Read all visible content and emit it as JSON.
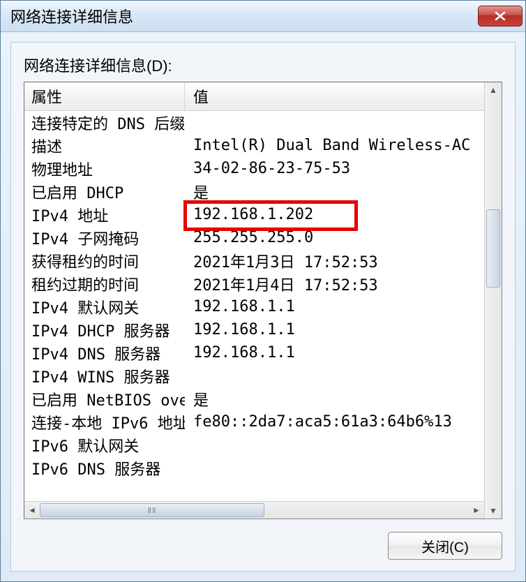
{
  "window": {
    "title": "网络连接详细信息"
  },
  "subtitle": "网络连接详细信息(D):",
  "columns": {
    "property": "属性",
    "value": "值"
  },
  "rows": [
    {
      "property": "连接特定的 DNS 后缀",
      "value": ""
    },
    {
      "property": "描述",
      "value": "Intel(R) Dual Band Wireless-AC"
    },
    {
      "property": "物理地址",
      "value": "34-02-86-23-75-53"
    },
    {
      "property": "已启用 DHCP",
      "value": "是"
    },
    {
      "property": "IPv4 地址",
      "value": "192.168.1.202"
    },
    {
      "property": "IPv4 子网掩码",
      "value": "255.255.255.0"
    },
    {
      "property": "获得租约的时间",
      "value": "2021年1月3日 17:52:53"
    },
    {
      "property": "租约过期的时间",
      "value": "2021年1月4日 17:52:53"
    },
    {
      "property": "IPv4 默认网关",
      "value": "192.168.1.1"
    },
    {
      "property": "IPv4 DHCP 服务器",
      "value": "192.168.1.1"
    },
    {
      "property": "IPv4 DNS 服务器",
      "value": "192.168.1.1"
    },
    {
      "property": "IPv4 WINS 服务器",
      "value": ""
    },
    {
      "property": "已启用 NetBIOS ove...",
      "value": "是"
    },
    {
      "property": "连接-本地 IPv6 地址",
      "value": "fe80::2da7:aca5:61a3:64b6%13"
    },
    {
      "property": "IPv6 默认网关",
      "value": ""
    },
    {
      "property": "IPv6 DNS 服务器",
      "value": ""
    }
  ],
  "highlighted_row_index": 4,
  "buttons": {
    "close": "关闭(C)"
  },
  "hscroll_grip": "ⅡⅡ"
}
